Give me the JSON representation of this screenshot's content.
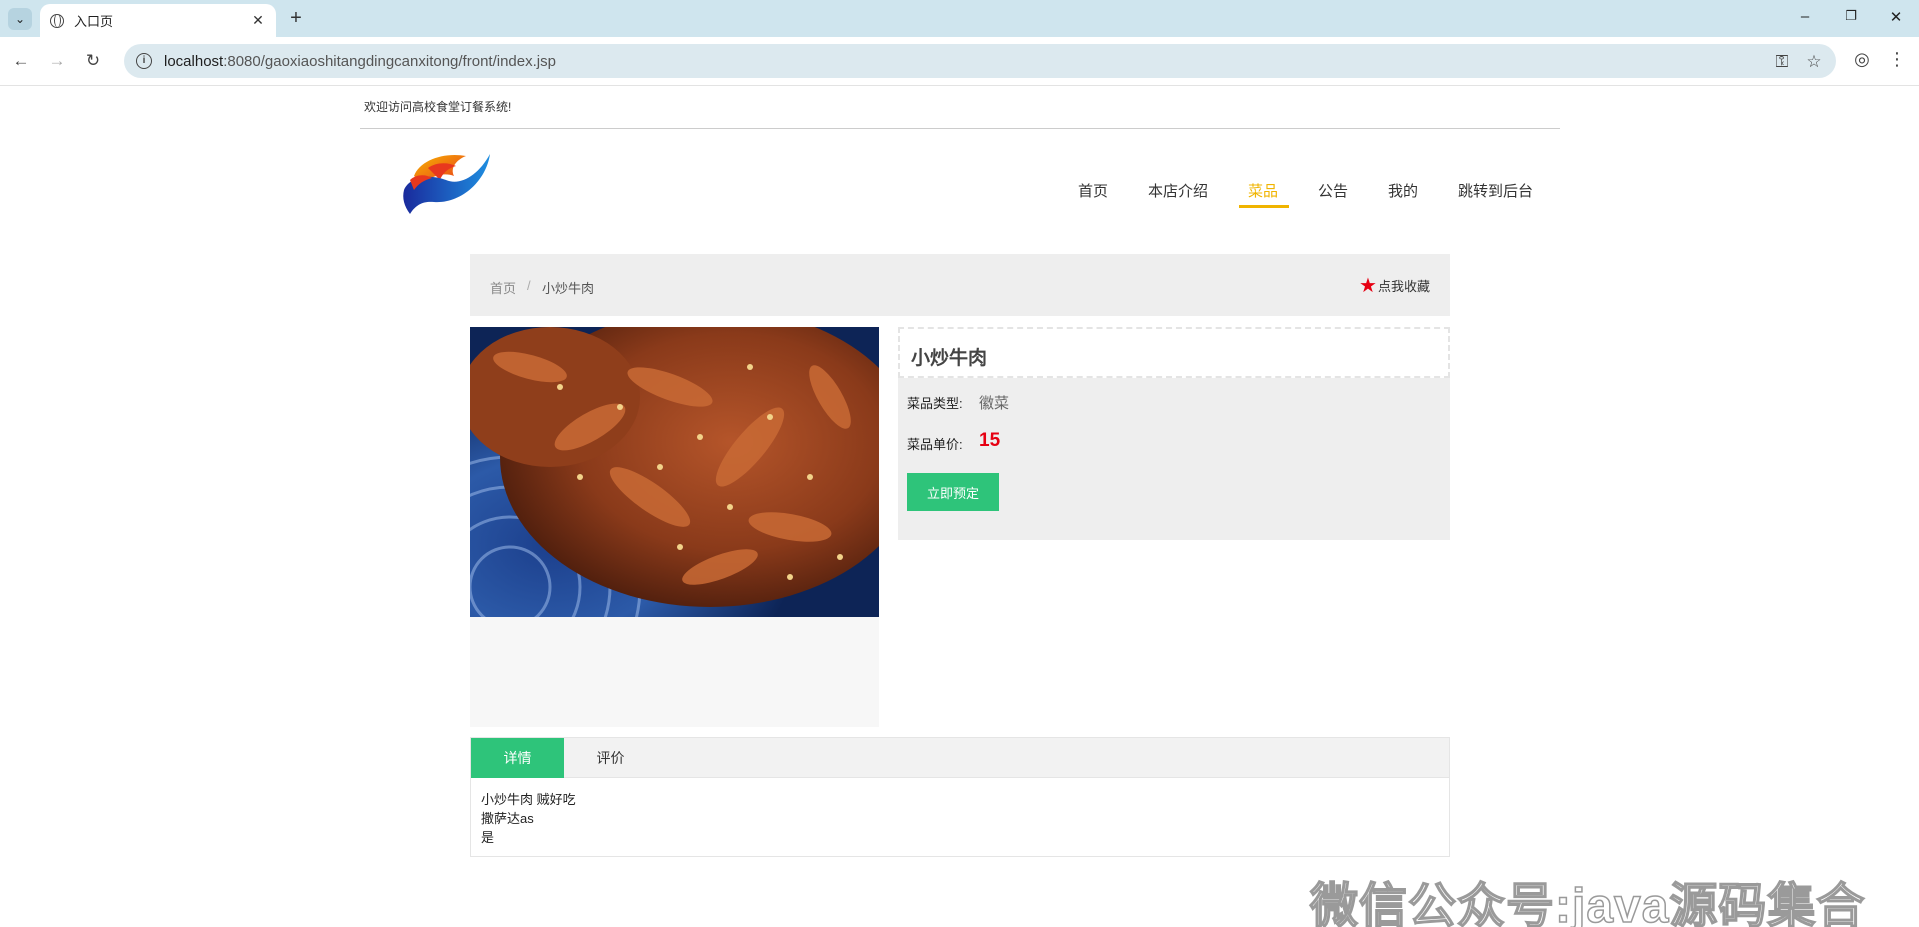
{
  "browser": {
    "tab_title": "入口页",
    "url_host": "localhost",
    "url_path": ":8080/gaoxiaoshitangdingcanxitong/front/index.jsp"
  },
  "site": {
    "welcome": "欢迎访问高校食堂订餐系统!",
    "nav": [
      "首页",
      "本店介绍",
      "菜品",
      "公告",
      "我的",
      "跳转到后台"
    ],
    "active_nav": "菜品",
    "accent_color": "#f0b400"
  },
  "breadcrumb": {
    "home": "首页",
    "separator": "/",
    "current": "小炒牛肉"
  },
  "favorite_label": "点我收藏",
  "dish": {
    "name": "小炒牛肉",
    "type_label": "菜品类型:",
    "type_value": "徽菜",
    "price_label": "菜品单价:",
    "price_value": "15",
    "order_button": "立即预定"
  },
  "detail_tabs": {
    "tabs": [
      "详情",
      "评价"
    ],
    "content_lines": [
      "小炒牛肉 贼好吃",
      "撒萨达as",
      "是"
    ]
  },
  "watermark": "微信公众号:java源码集合",
  "colors": {
    "primary_green": "#2ec47a",
    "price_red": "#e60012"
  }
}
